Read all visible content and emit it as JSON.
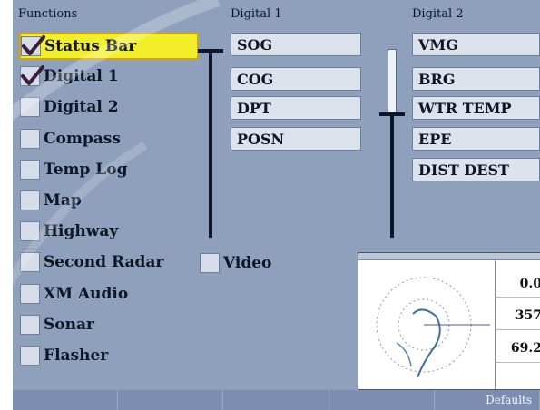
{
  "headers": {
    "functions": "Functions",
    "digital1": "Digital 1",
    "digital2": "Digital 2"
  },
  "functions": [
    {
      "label": "Status Bar",
      "checked": true,
      "selected": true
    },
    {
      "label": "Digital 1",
      "checked": true,
      "selected": false
    },
    {
      "label": "Digital 2",
      "checked": false,
      "selected": false
    },
    {
      "label": "Compass",
      "checked": false,
      "selected": false
    },
    {
      "label": "Temp Log",
      "checked": false,
      "selected": false
    },
    {
      "label": "Map",
      "checked": false,
      "selected": false
    },
    {
      "label": "Highway",
      "checked": false,
      "selected": false
    },
    {
      "label": "Second Radar",
      "checked": false,
      "selected": false
    },
    {
      "label": "XM Audio",
      "checked": false,
      "selected": false
    },
    {
      "label": "Sonar",
      "checked": false,
      "selected": false
    },
    {
      "label": "Flasher",
      "checked": false,
      "selected": false
    }
  ],
  "digital1_fields": [
    "SOG",
    "COG",
    "DPT",
    "POSN"
  ],
  "digital2_fields": [
    "VMG",
    "BRG",
    "WTR TEMP",
    "EPE",
    "DIST DEST"
  ],
  "video": {
    "label": "Video",
    "checked": false
  },
  "preview": {
    "values": [
      "0.0",
      "357",
      "69.2"
    ]
  },
  "softkeys": [
    "",
    "",
    "",
    "",
    "Defaults"
  ],
  "colors": {
    "screen_bg": "#8ea0bc",
    "selection": "#f2ef2a",
    "checkmark": "#3a1f3a"
  }
}
